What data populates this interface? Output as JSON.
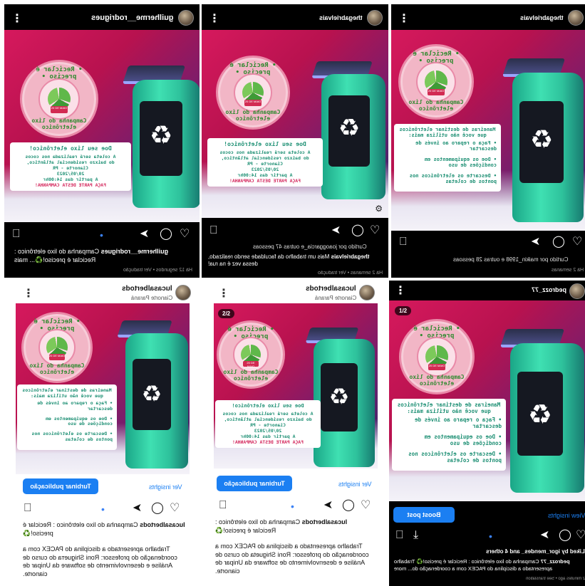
{
  "posts": [
    {
      "username": "guilherme__rodrigues",
      "caption_user": "guilherme__rodrigues",
      "caption_text": "Campanha do lixo eletrônico : Reciclar é preciso!♻️... mais",
      "meta": "Há 12 segundos • Ver tradução"
    },
    {
      "username": "thegabrielvais",
      "liked_by": "Curtido por joaoggarcia_e outras 47 pessoas",
      "caption_user": "thegabrielvais",
      "caption_text": "Mais um trabalho da faculdade sendo realizado, dessa vez é na rua!",
      "meta": "Há 2 semanas • Ver tradução"
    },
    {
      "username": "thegabrielvais",
      "liked_by": "Curtido por maikin_1998 e outras 28 pessoas",
      "meta": "Há 2 semanas"
    },
    {
      "username": "lucasalbertods",
      "location": "Cianorte Paraná",
      "boost": "Turbinar publicação",
      "insights": "Ver insights",
      "caption_user": "lucasalbertods",
      "caption_text": "Campanha do lixo eletrônico : Reciclar é preciso!♻️",
      "body": "Trabalho apresentado a disciplina do PACEX com a coordenação do professor: Roni Shiguета do curso de Análise e desenvolvimento de software da Unipar de cianorte."
    },
    {
      "username": "lucasalbertods",
      "location": "Cianorte Paraná",
      "pager": "2/2",
      "boost": "Turbinar publicação",
      "insights": "Ver insights",
      "caption_user": "lucasalbertods",
      "caption_text": "Campanha do lixo eletrônico : Reciclar é preciso!♻️",
      "body": "Trabalho apresentado a disciplina do PACEX com a coordenação do professor: Roni Shigueta do curso de Análise e desenvolvimento de software da Unipar de cianorte."
    },
    {
      "username": "pedrozz_77",
      "pager": "1/2",
      "boost": "Boost post",
      "insights": "View insights",
      "liked_by": "Liked by igor_mendes_ and 4 others",
      "caption_user": "pedrozz_77",
      "caption_text": "Campanha do lixo eletrônico : Reciclar é preciso!♻️ Trabalho apresentado a disciplina do PACEX com a coordenação do... more",
      "meta": "2 minutes ago • See translation"
    }
  ],
  "poster": {
    "ring_top": "• Reciclar é preciso •",
    "ring_bottom": "Campanha do lixo eletrônico",
    "date_pill": "20 DE MAIO",
    "doe_title": "Doe seu lixo eletrônico!",
    "doe_lines": [
      "A coleta será realizada nos cocos",
      "do baixzo residencial atlântico,",
      "Cianorte - PR",
      "20/05/2023",
      "A partir das 14:00hr"
    ],
    "doe_red": "FAÇA PARTE DESTA CAMPANHA!",
    "ways_title": "Maneiras de destinar eletrônicos que você não utiliza mais:",
    "bullets": [
      "• Faça o reparo ao invés de descartar",
      "• Doe os equipamentos em condições de uso",
      "• Descarte os eletrônicos nos pontos de coletas"
    ],
    "recycle_symbol": "♻"
  },
  "icons": {
    "menu": "⋮",
    "heart": "♡",
    "comment": "◯",
    "share": "➤",
    "bookmark": "⎕",
    "download": "⤓",
    "dot": "•"
  },
  "colors": {
    "accent_blue": "#1b7ff2",
    "poster_magenta": "#d6195d",
    "poster_teal": "#2ec29c",
    "poster_green_text": "#1c8f73",
    "poster_red_text": "#d3245a"
  }
}
